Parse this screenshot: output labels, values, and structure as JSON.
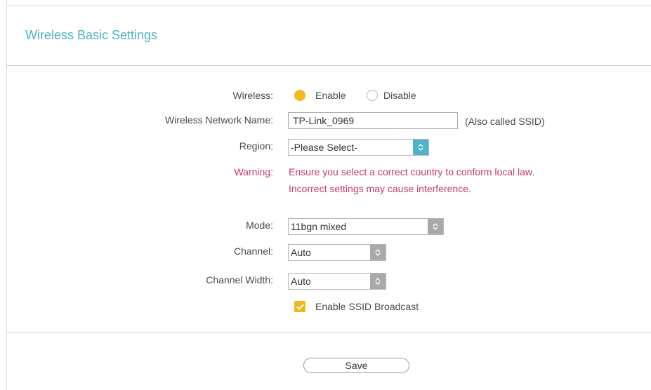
{
  "title": "Wireless Basic Settings",
  "wireless": {
    "label": "Wireless:",
    "enable_label": "Enable",
    "disable_label": "Disable",
    "selected": "Enable"
  },
  "ssid": {
    "label": "Wireless Network Name:",
    "value": "TP-Link_0969",
    "hint": "(Also called SSID)"
  },
  "region": {
    "label": "Region:",
    "value": "-Please Select-"
  },
  "warning": {
    "label": "Warning:",
    "line1": "Ensure you select a correct country to conform local law.",
    "line2": "Incorrect settings may cause interference."
  },
  "mode": {
    "label": "Mode:",
    "value": "11bgn mixed"
  },
  "channel": {
    "label": "Channel:",
    "value": "Auto"
  },
  "channel_width": {
    "label": "Channel Width:",
    "value": "Auto"
  },
  "ssid_broadcast": {
    "label": "Enable SSID Broadcast",
    "checked": true
  },
  "save_label": "Save",
  "colors": {
    "accent": "#4eb3c9",
    "radio_on": "#f2b81e",
    "warning": "#c73a5d"
  },
  "icons": {
    "select_arrow": "chevron-up-down-icon",
    "check": "checkmark-icon"
  }
}
